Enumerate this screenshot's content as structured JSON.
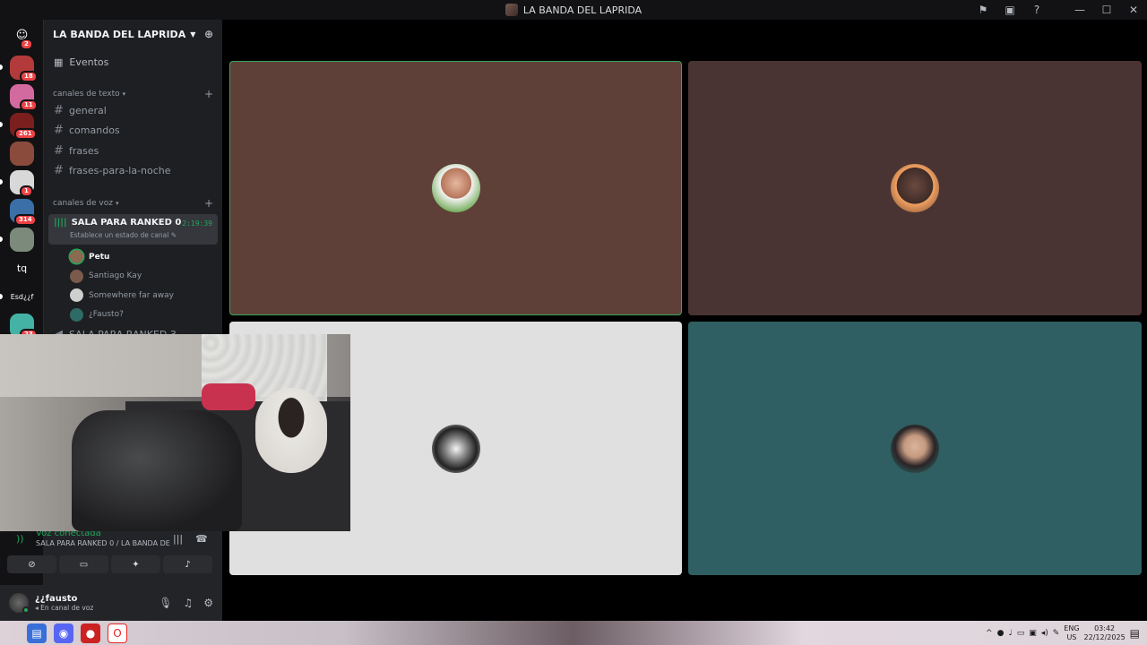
{
  "window": {
    "title": "LA BANDA DEL LAPRIDA"
  },
  "rail": {
    "servers": [
      {
        "name": "discord-home",
        "badge": "2",
        "color": "#5865f2"
      },
      {
        "name": "server-1",
        "badge": "18",
        "color": "#b33a3a"
      },
      {
        "name": "server-2",
        "badge": "11",
        "color": "#d26aa0"
      },
      {
        "name": "server-3",
        "badge": "261",
        "color": "#7a1e1e"
      },
      {
        "name": "server-4",
        "badge": "",
        "color": "#8a4b3c"
      },
      {
        "name": "server-5",
        "badge": "1",
        "color": "#d8d8d8"
      },
      {
        "name": "server-6",
        "badge": "314",
        "color": "#3a6fa8"
      },
      {
        "name": "server-7",
        "badge": "",
        "color": "#7b8a7a"
      },
      {
        "name": "server-tq",
        "label": "tq",
        "badge": "",
        "color": "#121214"
      },
      {
        "name": "server-esd",
        "label": "Esd¿¿f",
        "badge": "",
        "color": "#121214"
      },
      {
        "name": "server-last",
        "badge": "23",
        "color": "#44b3a6"
      }
    ]
  },
  "guild": {
    "name": "LA BANDA DEL LAPRIDA",
    "events": "Eventos",
    "text_category": "canales de texto",
    "text_channels": [
      "general",
      "comandos",
      "frases",
      "frases-para-la-noche"
    ],
    "voice_category": "canales de voz",
    "voice_channel": {
      "name": "SALA PARA RANKED 0",
      "timer": "2:19:39",
      "status": "Establece un estado de canal",
      "members": [
        {
          "name": "Petu",
          "active": true,
          "color": "#8a6a50"
        },
        {
          "name": "Santiago Kay",
          "active": false,
          "color": "#7a5a4a"
        },
        {
          "name": "Somewhere far away",
          "active": false,
          "color": "#cfcfcf"
        },
        {
          "name": "¿Fausto?",
          "active": false,
          "color": "#2e6b66"
        }
      ]
    },
    "next_voice": "SALA PARA RANKED 3"
  },
  "voice_panel": {
    "status": "Voz conectada",
    "channel": "SALA PARA RANKED 0 / LA BANDA DE..."
  },
  "user": {
    "name": "¿¿fausto",
    "status": "En canal de voz"
  },
  "tiles": [
    {
      "id": "petu",
      "bg": "#5e4038",
      "speaking": true
    },
    {
      "id": "santiago",
      "bg": "#4a3433",
      "speaking": false
    },
    {
      "id": "somewhere",
      "bg": "#e0e0e0",
      "speaking": false
    },
    {
      "id": "fausto",
      "bg": "#2f5f62",
      "speaking": false
    }
  ],
  "taskbar": {
    "lang_top": "ENG",
    "lang_bottom": "US",
    "time": "03:42",
    "date": "22/12/2025"
  },
  "colors": {
    "accent_green": "#23a55a",
    "speaking_border": "#3ba55c",
    "badge_red": "#ed4245"
  }
}
